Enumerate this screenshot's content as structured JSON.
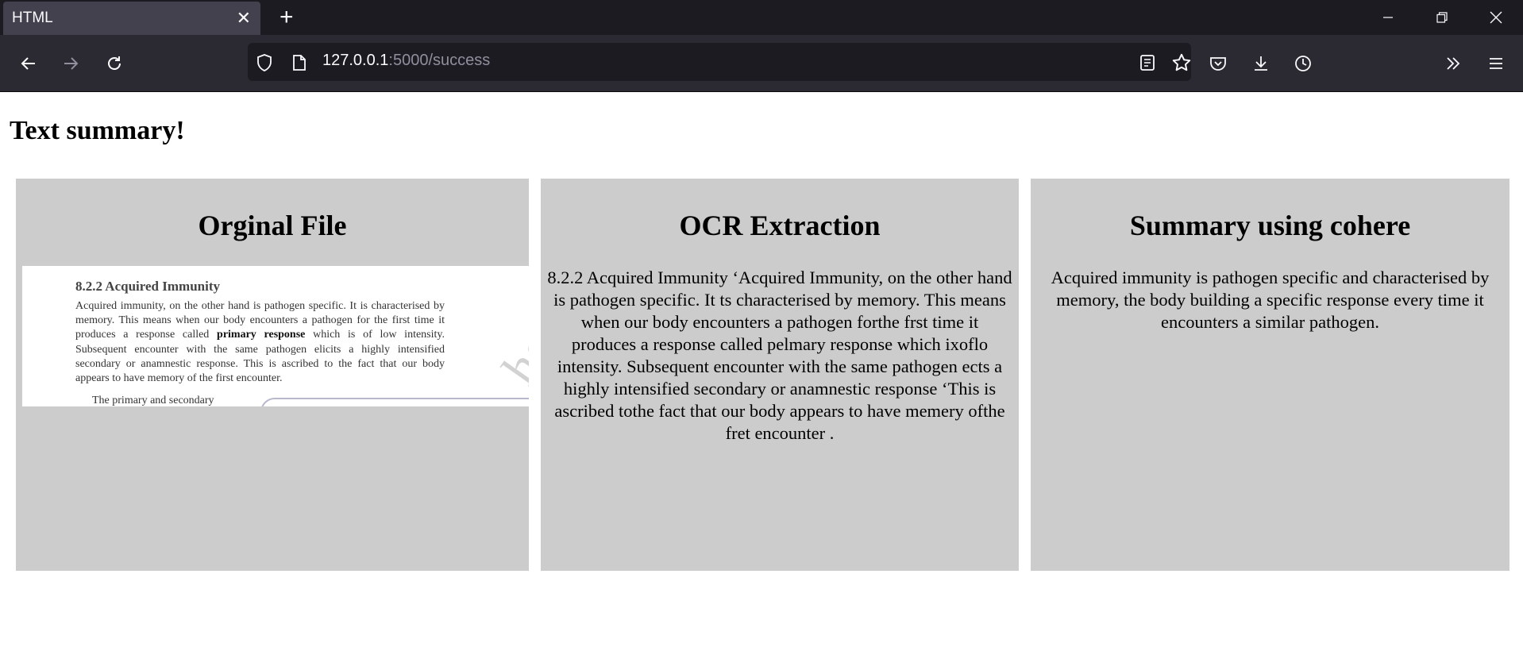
{
  "browser": {
    "tab_title": "HTML",
    "url_host": "127.0.0.1",
    "url_rest": ":5000/success"
  },
  "page": {
    "title": "Text summary!"
  },
  "panels": {
    "original": {
      "heading": "Orginal File",
      "image": {
        "section_heading": "8.2.2 Acquired Immunity",
        "text_before_bold": "Acquired immunity, on the other hand is pathogen specific. It is characterised by memory. This means when our body encounters a pathogen for the first time it produces a response called ",
        "bold_text": "primary response",
        "text_after_bold": " which is of low intensity. Subsequent encounter with the same pathogen elicits a highly intensified secondary or anamnestic response. This is ascribed to the fact that our body appears to have memory of the first encounter.",
        "cut_off_line": "The primary and secondary",
        "watermark": "hed"
      }
    },
    "ocr": {
      "heading": "OCR Extraction",
      "text": "8.2.2 Acquired Immunity ‘Acquired Immunity, on the other hand is pathogen specific. It ts characterised by memory. This means when our body encounters a pathogen forthe frst time it produces a response called pelmary response which ixoflo intensity. Subsequent encounter with the same pathogen ects a highly intensified secondary or anamnestic response ‘This is ascribed tothe fact that our body appears to have memery ofthe fret encounter ."
    },
    "summary": {
      "heading": "Summary using cohere",
      "text": "Acquired immunity is pathogen specific and characterised by memory, the body building a specific response every time it encounters a similar pathogen."
    }
  },
  "colors": {
    "tabbar_bg": "#1c1b22",
    "navbar_bg": "#2b2a33",
    "panel_bg": "#cccccc"
  }
}
